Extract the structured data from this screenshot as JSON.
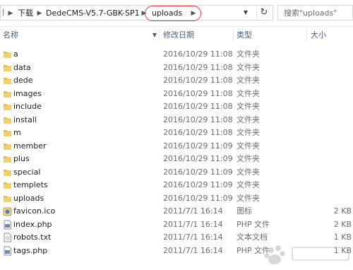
{
  "address": {
    "crumbs": [
      "下载",
      "DedeCMS-V5.7-GBK-SP1",
      "uploads"
    ]
  },
  "search": {
    "placeholder": "搜索\"uploads\""
  },
  "columns": {
    "name": "名称",
    "date": "修改日期",
    "type": "类型",
    "size": "大小"
  },
  "files": [
    {
      "name": "a",
      "date": "2016/10/29 11:08",
      "type": "文件夹",
      "size": "",
      "icon": "folder-icon"
    },
    {
      "name": "data",
      "date": "2016/10/29 11:08",
      "type": "文件夹",
      "size": "",
      "icon": "folder-icon"
    },
    {
      "name": "dede",
      "date": "2016/10/29 11:08",
      "type": "文件夹",
      "size": "",
      "icon": "folder-icon"
    },
    {
      "name": "images",
      "date": "2016/10/29 11:08",
      "type": "文件夹",
      "size": "",
      "icon": "folder-icon"
    },
    {
      "name": "include",
      "date": "2016/10/29 11:08",
      "type": "文件夹",
      "size": "",
      "icon": "folder-icon"
    },
    {
      "name": "install",
      "date": "2016/10/29 11:08",
      "type": "文件夹",
      "size": "",
      "icon": "folder-icon"
    },
    {
      "name": "m",
      "date": "2016/10/29 11:08",
      "type": "文件夹",
      "size": "",
      "icon": "folder-icon"
    },
    {
      "name": "member",
      "date": "2016/10/29 11:09",
      "type": "文件夹",
      "size": "",
      "icon": "folder-icon"
    },
    {
      "name": "plus",
      "date": "2016/10/29 11:09",
      "type": "文件夹",
      "size": "",
      "icon": "folder-icon"
    },
    {
      "name": "special",
      "date": "2016/10/29 11:09",
      "type": "文件夹",
      "size": "",
      "icon": "folder-icon"
    },
    {
      "name": "templets",
      "date": "2016/10/29 11:09",
      "type": "文件夹",
      "size": "",
      "icon": "folder-icon"
    },
    {
      "name": "uploads",
      "date": "2016/10/29 11:09",
      "type": "文件夹",
      "size": "",
      "icon": "folder-icon"
    },
    {
      "name": "favicon.ico",
      "date": "2011/7/1 16:14",
      "type": "图标",
      "size": "2 KB",
      "icon": "ico-file-icon"
    },
    {
      "name": "index.php",
      "date": "2011/7/1 16:14",
      "type": "PHP 文件",
      "size": "2 KB",
      "icon": "php-file-icon"
    },
    {
      "name": "robots.txt",
      "date": "2011/7/1 16:14",
      "type": "文本文档",
      "size": "1 KB",
      "icon": "text-file-icon"
    },
    {
      "name": "tags.php",
      "date": "2011/7/1 16:14",
      "type": "PHP 文件",
      "size": "1 KB",
      "icon": "php-file-icon"
    }
  ],
  "colors": {
    "highlight_circle": "#e23b3b",
    "folder": "#e8b94a",
    "header_text": "#4c607a"
  }
}
